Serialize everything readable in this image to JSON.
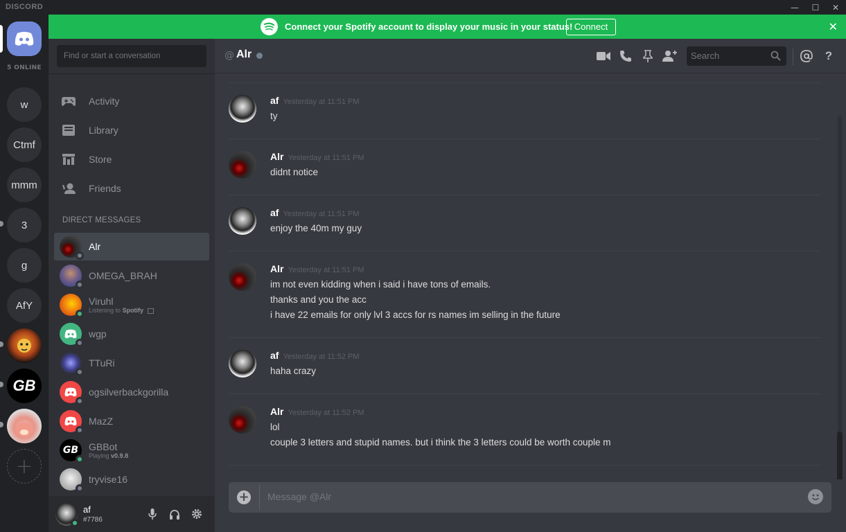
{
  "app": {
    "brand": "DISCORD"
  },
  "window_controls": {
    "minimize": "—",
    "maximize": "☐",
    "close": "✕"
  },
  "servers": {
    "online_count": "5 ONLINE",
    "guilds": [
      {
        "label": "w"
      },
      {
        "label": "Ctmf"
      },
      {
        "label": "mmm"
      },
      {
        "label": "3"
      },
      {
        "label": "g"
      },
      {
        "label": "AfY"
      },
      {
        "label": ""
      },
      {
        "label": ""
      },
      {
        "label": ""
      }
    ],
    "add": "+"
  },
  "banner": {
    "text": "Connect your Spotify account to display your music in your status!",
    "button": "Connect",
    "close": "✕",
    "color": "#1db954"
  },
  "sidebar": {
    "search_placeholder": "Find or start a conversation",
    "nav": [
      {
        "label": "Activity",
        "icon": "gamepad-icon"
      },
      {
        "label": "Library",
        "icon": "library-icon"
      },
      {
        "label": "Store",
        "icon": "store-icon"
      },
      {
        "label": "Friends",
        "icon": "friends-icon"
      }
    ],
    "dm_header": "DIRECT MESSAGES",
    "dms": [
      {
        "name": "Alr",
        "status": "offline",
        "active": true
      },
      {
        "name": "OMEGA_BRAH",
        "status": "offline"
      },
      {
        "name": "Viruhl",
        "status": "online",
        "sub_prefix": "Listening to",
        "sub_bold": "Spotify"
      },
      {
        "name": "wgp",
        "status": "offline"
      },
      {
        "name": "TTuRi",
        "status": "offline"
      },
      {
        "name": "ogsilverbackgorilla",
        "status": "offline"
      },
      {
        "name": "MazZ",
        "status": "offline"
      },
      {
        "name": "GBBot",
        "status": "online",
        "sub_prefix": "Playing",
        "sub_bold": "v0.9.8"
      },
      {
        "name": "tryvise16",
        "status": "offline"
      }
    ]
  },
  "user": {
    "name": "af",
    "tag": "#7786"
  },
  "chat": {
    "at": "@",
    "channel": "Alr",
    "search_placeholder": "Search",
    "composer_placeholder": "Message @Alr",
    "messages": [
      {
        "author": "af",
        "time": "Yesterday at 11:51 PM",
        "lines": [
          "ty"
        ]
      },
      {
        "author": "Alr",
        "time": "Yesterday at 11:51 PM",
        "lines": [
          "didnt notice"
        ]
      },
      {
        "author": "af",
        "time": "Yesterday at 11:51 PM",
        "lines": [
          "enjoy the 40m my guy"
        ]
      },
      {
        "author": "Alr",
        "time": "Yesterday at 11:51 PM",
        "lines": [
          "im not even kidding when i said i have tons of emails.",
          "thanks and you the acc",
          "i have 22 emails for only lvl 3 accs for rs names im selling in the future"
        ]
      },
      {
        "author": "af",
        "time": "Yesterday at 11:52 PM",
        "lines": [
          "haha crazy"
        ]
      },
      {
        "author": "Alr",
        "time": "Yesterday at 11:52 PM",
        "lines": [
          "lol",
          "couple 3 letters and stupid names. but i think the 3 letters could be worth couple m"
        ]
      }
    ]
  },
  "colors": {
    "blurple": "#7289da",
    "online": "#43b581",
    "offline": "#747f8d"
  }
}
